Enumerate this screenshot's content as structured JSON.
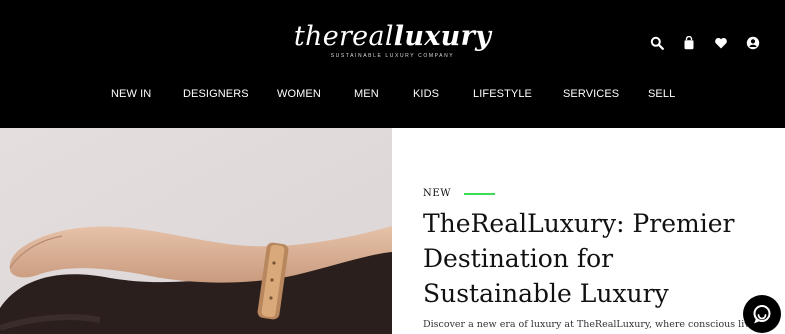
{
  "header": {
    "logo_prefix": "thereal",
    "logo_suffix": "luxury",
    "tagline": "SUSTAINABLE LUXURY COMPANY",
    "icons": [
      "search-icon",
      "bag-icon",
      "heart-icon",
      "account-icon"
    ]
  },
  "nav": {
    "items": [
      {
        "label": "NEW IN"
      },
      {
        "label": "DESIGNERS"
      },
      {
        "label": "WOMEN"
      },
      {
        "label": "MEN"
      },
      {
        "label": "KIDS"
      },
      {
        "label": "LIFESTYLE"
      },
      {
        "label": "SERVICES"
      },
      {
        "label": "SELL"
      }
    ]
  },
  "hero": {
    "kicker": "NEW",
    "title": "TheRealLuxury: Premier Destination for Sustainable Luxury",
    "description": "Discover a new era of luxury at TheRealLuxury, where conscious living"
  },
  "chat": {
    "icon": "chat-icon"
  },
  "colors": {
    "accent": "#3ddc56",
    "header_bg": "#000000"
  }
}
